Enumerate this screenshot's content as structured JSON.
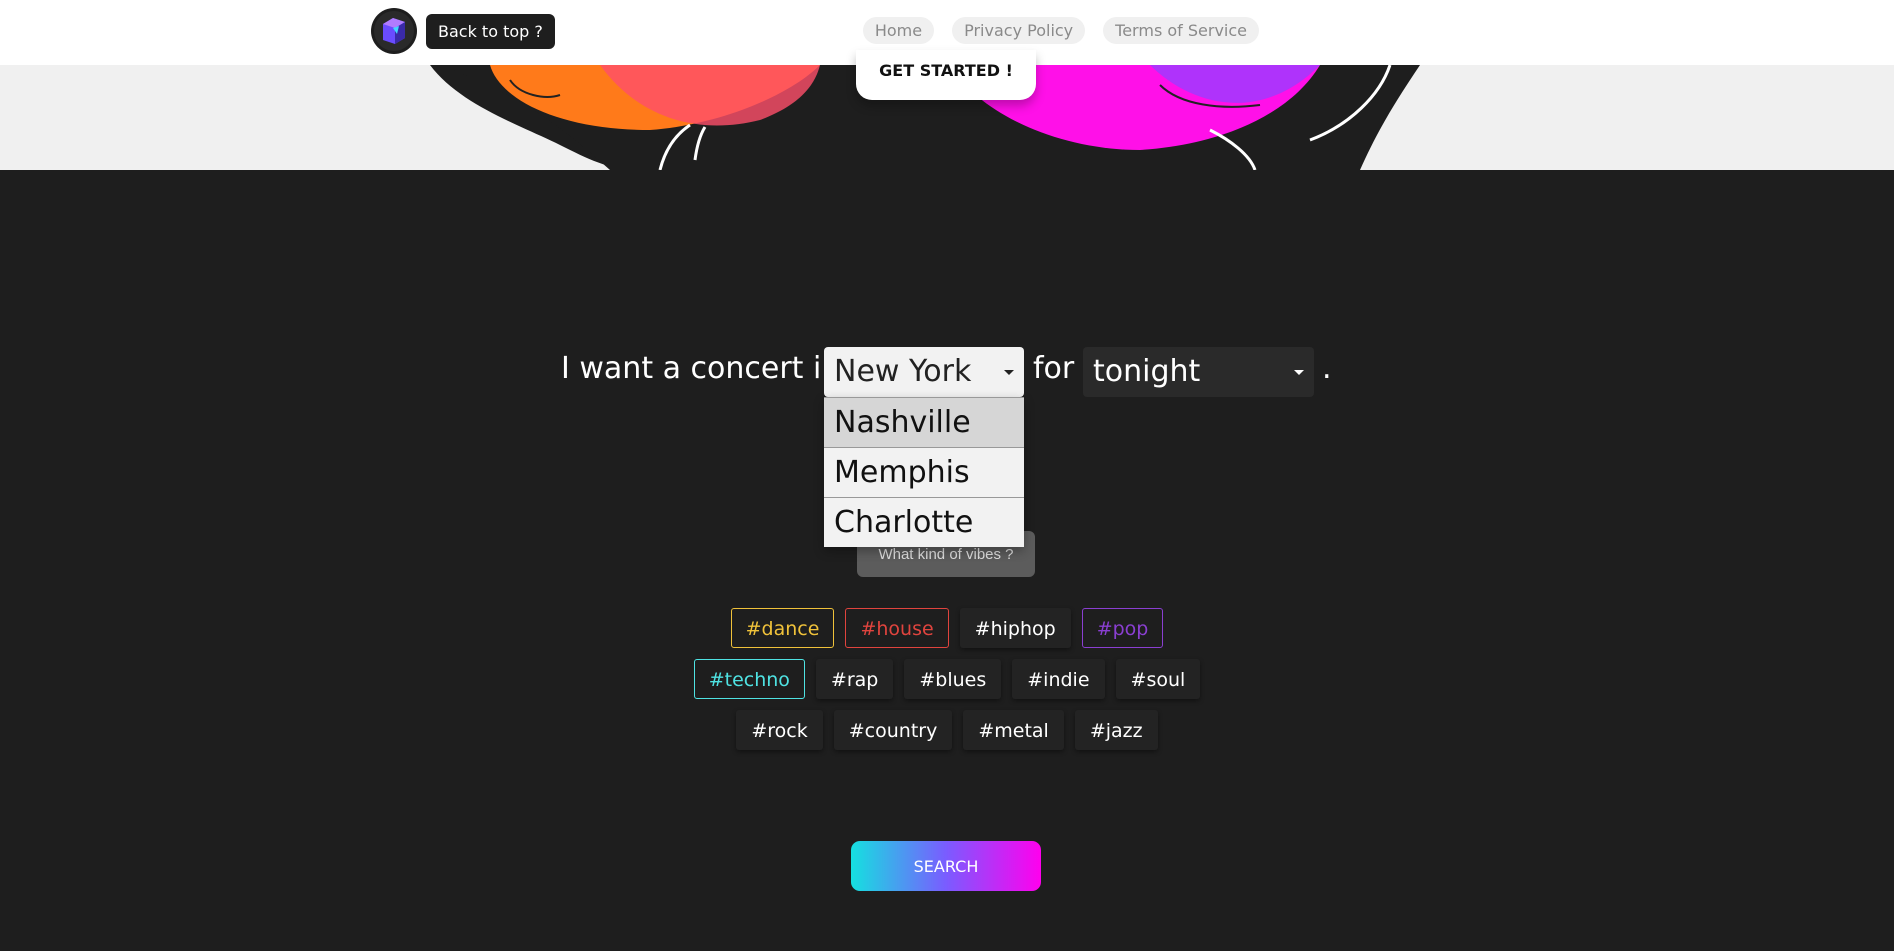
{
  "header": {
    "back_to_top": "Back to top ?",
    "nav": [
      "Home",
      "Privacy Policy",
      "Terms of Service"
    ]
  },
  "hero": {
    "cta": "GET STARTED !"
  },
  "query": {
    "prefix": "I want a concert in",
    "middle": "for",
    "suffix": ".",
    "city_selected": "New York",
    "city_options": [
      "Nashville",
      "Memphis",
      "Charlotte"
    ],
    "time_selected": "tonight"
  },
  "vibes_button": "What kind of vibes ?",
  "tags": [
    [
      {
        "label": "#dance",
        "color": "#f0c23a"
      },
      {
        "label": "#house",
        "color": "#e0443e"
      },
      {
        "label": "#hiphop",
        "color": "#ffffff"
      },
      {
        "label": "#pop",
        "color": "#8a3fd1"
      }
    ],
    [
      {
        "label": "#techno",
        "color": "#4fe3e3"
      },
      {
        "label": "#rap",
        "color": "#ffffff"
      },
      {
        "label": "#blues",
        "color": "#ffffff"
      },
      {
        "label": "#indie",
        "color": "#ffffff"
      },
      {
        "label": "#soul",
        "color": "#ffffff"
      }
    ],
    [
      {
        "label": "#rock",
        "color": "#ffffff"
      },
      {
        "label": "#country",
        "color": "#ffffff"
      },
      {
        "label": "#metal",
        "color": "#ffffff"
      },
      {
        "label": "#jazz",
        "color": "#ffffff"
      }
    ]
  ],
  "active_tags": [
    "#dance",
    "#house",
    "#pop",
    "#techno"
  ],
  "search_label": "SEARCH"
}
